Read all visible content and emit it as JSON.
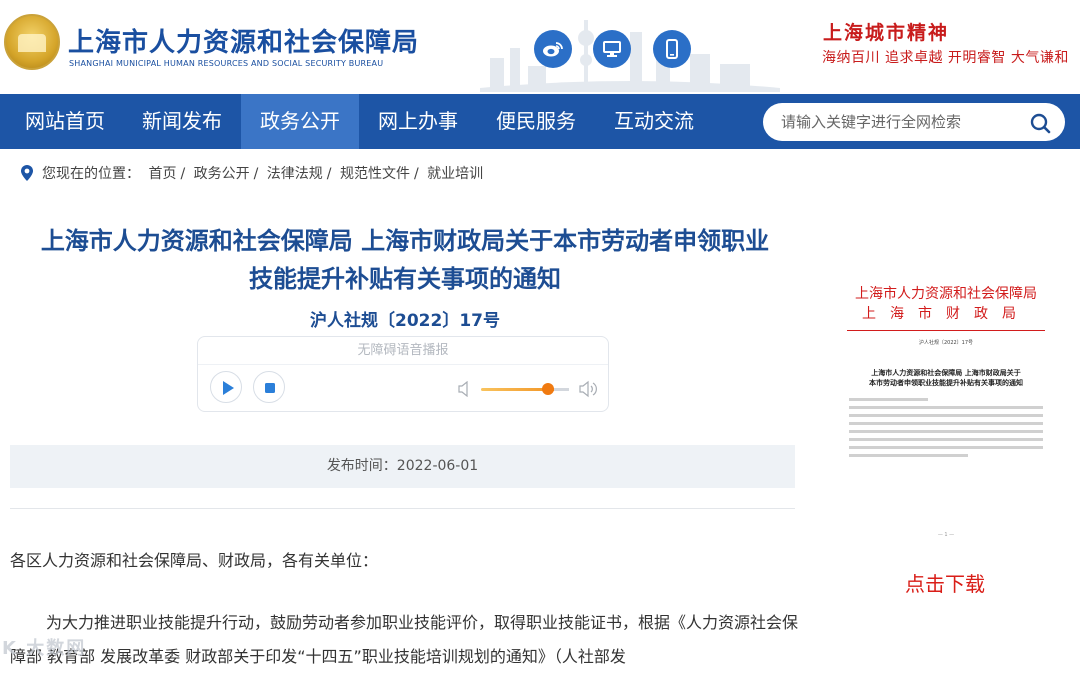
{
  "header": {
    "title": "上海市人力资源和社会保障局",
    "subtitle": "SHANGHAI MUNICIPAL HUMAN RESOURCES AND SOCIAL SECURITY BUREAU",
    "icons": [
      "weibo-icon",
      "desktop-icon",
      "mobile-icon"
    ],
    "spirit_title": "上海城市精神",
    "spirit_motto": "海纳百川  追求卓越  开明睿智  大气谦和"
  },
  "nav": {
    "items": [
      "网站首页",
      "新闻发布",
      "政务公开",
      "网上办事",
      "便民服务",
      "互动交流"
    ],
    "active_index": 2
  },
  "search": {
    "placeholder": "请输入关键字进行全网检索"
  },
  "breadcrumb": {
    "prefix": "您现在的位置：",
    "items": [
      "首页",
      "政务公开",
      "法律法规",
      "规范性文件",
      "就业培训"
    ]
  },
  "article": {
    "title_line1": "上海市人力资源和社会保障局 上海市财政局关于本市劳动者申领职业",
    "title_line2": "技能提升补贴有关事项的通知",
    "doc_number": "沪人社规〔2022〕17号",
    "player_label": "无障碍语音播报",
    "publish_time": "发布时间：2022-06-01",
    "salutation": "各区人力资源和社会保障局、财政局，各有关单位：",
    "body": "为大力推进职业技能提升行动，鼓励劳动者参加职业技能评价，取得职业技能证书，根据《人力资源社会保障部 教育部 发展改革委 财政部关于印发“十四五”职业技能培训规划的通知》（人社部发"
  },
  "preview": {
    "issuer1": "上海市人力资源和社会保障局",
    "issuer2": "上海市财政局",
    "number": "沪人社规〔2022〕17号",
    "title1": "上海市人力资源和社会保障局 上海市财政局关于",
    "title2": "本市劳动者申领职业技能提升补贴有关事项的通知",
    "page": "— 1 —"
  },
  "download_label": "点击下载",
  "volume_level": 0.75,
  "colors": {
    "brand_blue": "#1d55a6",
    "nav_active": "#3b75c6",
    "title_blue": "#1d4d93",
    "accent_red": "#d91e18",
    "volume_orange": "#f07a10"
  }
}
